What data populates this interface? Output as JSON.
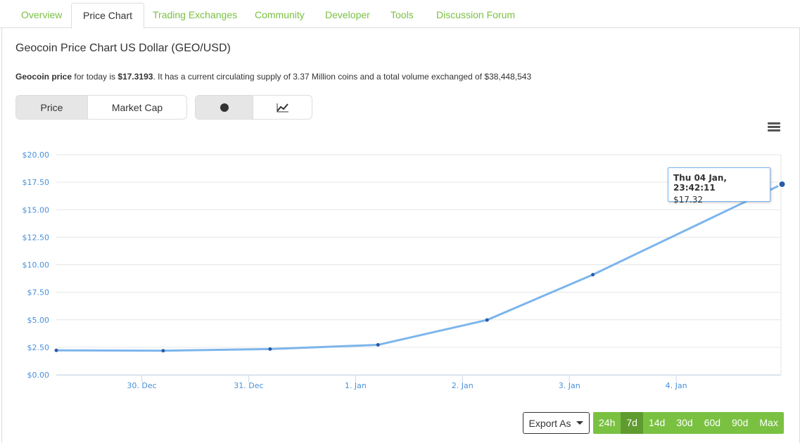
{
  "tabs": [
    {
      "label": "Overview",
      "active": false
    },
    {
      "label": "Price Chart",
      "active": true
    },
    {
      "label": "Trading Exchanges",
      "active": false
    },
    {
      "label": "Community",
      "active": false
    },
    {
      "label": "Developer",
      "active": false
    },
    {
      "label": "Tools",
      "active": false
    },
    {
      "label": "Discussion Forum",
      "active": false
    }
  ],
  "heading": "Geocoin Price Chart US Dollar (GEO/USD)",
  "description": {
    "name_strong": "Geocoin price",
    "text1": " for today is ",
    "price_strong": "$17.3193",
    "text2": ". It has a current circulating supply of 3.37 Million coins and a total volume exchanged of $38,448,543"
  },
  "metric_toggle": {
    "price": "Price",
    "market_cap": "Market Cap",
    "selected": "Price"
  },
  "style_toggle": {
    "dot_icon": "dot-icon",
    "line_icon": "line-chart-icon",
    "selected": "dot"
  },
  "menu_icon": "hamburger-menu-icon",
  "tooltip": {
    "date": "Thu 04 Jan, 23:42:11",
    "value": "$17.32"
  },
  "export_label": "Export As",
  "ranges": [
    "24h",
    "7d",
    "14d",
    "30d",
    "60d",
    "90d",
    "Max"
  ],
  "selected_range": "7d",
  "colors": {
    "accent": "#7ac142",
    "line": "#7cb5ec",
    "point": "#2b5ba8",
    "axis_text": "#4a90d9"
  },
  "chart_data": {
    "type": "line",
    "title": "",
    "xlabel": "",
    "ylabel": "",
    "x_ticks": [
      "30. Dec",
      "31. Dec",
      "1. Jan",
      "2. Jan",
      "3. Jan",
      "4. Jan"
    ],
    "y_ticks": [
      "$0.00",
      "$2.50",
      "$5.00",
      "$7.50",
      "$10.00",
      "$12.50",
      "$15.00",
      "$17.50",
      "$20.00"
    ],
    "ylim": [
      0,
      20
    ],
    "xlim_days": [
      -0.8,
      5.98
    ],
    "grid": true,
    "series": [
      {
        "x": [
          "29 Dec 00:00",
          "29 Dec 23:45",
          "31 Dec 00:00",
          "1 Jan 00:10",
          "2 Jan 00:50",
          "3 Jan 00:40",
          "4 Jan 23:42"
        ],
        "x_days": [
          -0.8,
          0.2,
          1.2,
          2.21,
          3.23,
          4.22,
          5.99
        ],
        "values": [
          2.22,
          2.19,
          2.34,
          2.72,
          4.98,
          9.1,
          17.32
        ]
      }
    ]
  }
}
